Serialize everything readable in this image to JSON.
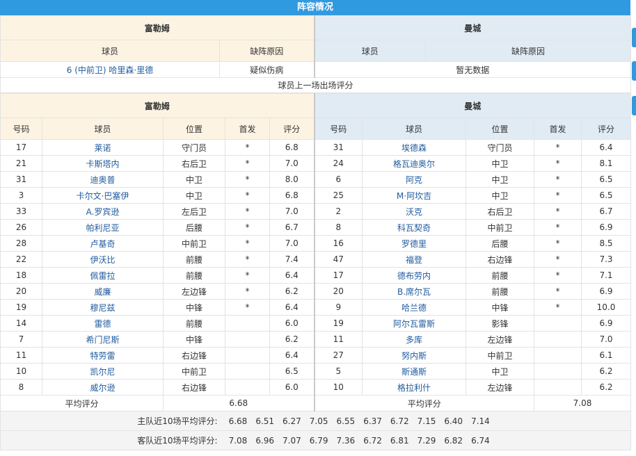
{
  "title": "阵容情况",
  "home_team": "富勒姆",
  "away_team": "曼城",
  "absence": {
    "col_player": "球员",
    "col_reason": "缺阵原因",
    "home_rows": [
      {
        "player": "6 (中前卫) 哈里森·里德",
        "reason": "疑似伤病"
      }
    ],
    "away_empty": "暂无数据"
  },
  "ratings_section": "球员上一场出场评分",
  "cols": {
    "num": "号码",
    "player": "球员",
    "pos": "位置",
    "start": "首发",
    "rating": "评分"
  },
  "home_players": [
    {
      "num": "17",
      "name": "莱诺",
      "pos": "守门员",
      "start": "*",
      "rating": "6.8"
    },
    {
      "num": "21",
      "name": "卡斯塔内",
      "pos": "右后卫",
      "start": "*",
      "rating": "7.0"
    },
    {
      "num": "31",
      "name": "迪奥普",
      "pos": "中卫",
      "start": "*",
      "rating": "8.0"
    },
    {
      "num": "3",
      "name": "卡尔文·巴塞伊",
      "pos": "中卫",
      "start": "*",
      "rating": "6.8"
    },
    {
      "num": "33",
      "name": "A.罗宾逊",
      "pos": "左后卫",
      "start": "*",
      "rating": "7.0"
    },
    {
      "num": "26",
      "name": "帕利尼亚",
      "pos": "后腰",
      "start": "*",
      "rating": "6.7"
    },
    {
      "num": "28",
      "name": "卢基奇",
      "pos": "中前卫",
      "start": "*",
      "rating": "7.0"
    },
    {
      "num": "22",
      "name": "伊沃比",
      "pos": "前腰",
      "start": "*",
      "rating": "7.4"
    },
    {
      "num": "18",
      "name": "佩雷拉",
      "pos": "前腰",
      "start": "*",
      "rating": "6.4"
    },
    {
      "num": "20",
      "name": "威廉",
      "pos": "左边锋",
      "start": "*",
      "rating": "6.2"
    },
    {
      "num": "19",
      "name": "穆尼兹",
      "pos": "中锋",
      "start": "*",
      "rating": "6.4"
    },
    {
      "num": "14",
      "name": "雷德",
      "pos": "前腰",
      "start": "",
      "rating": "6.0"
    },
    {
      "num": "7",
      "name": "希门尼斯",
      "pos": "中锋",
      "start": "",
      "rating": "6.2"
    },
    {
      "num": "11",
      "name": "特劳雷",
      "pos": "右边锋",
      "start": "",
      "rating": "6.4"
    },
    {
      "num": "10",
      "name": "凯尔尼",
      "pos": "中前卫",
      "start": "",
      "rating": "6.5"
    },
    {
      "num": "8",
      "name": "威尔逊",
      "pos": "右边锋",
      "start": "",
      "rating": "6.0"
    }
  ],
  "away_players": [
    {
      "num": "31",
      "name": "埃德森",
      "pos": "守门员",
      "start": "*",
      "rating": "6.4"
    },
    {
      "num": "24",
      "name": "格瓦迪奥尔",
      "pos": "中卫",
      "start": "*",
      "rating": "8.1"
    },
    {
      "num": "6",
      "name": "阿克",
      "pos": "中卫",
      "start": "*",
      "rating": "6.5"
    },
    {
      "num": "25",
      "name": "M·阿坎吉",
      "pos": "中卫",
      "start": "*",
      "rating": "6.5"
    },
    {
      "num": "2",
      "name": "沃克",
      "pos": "右后卫",
      "start": "*",
      "rating": "6.7"
    },
    {
      "num": "8",
      "name": "科瓦契奇",
      "pos": "中前卫",
      "start": "*",
      "rating": "6.9"
    },
    {
      "num": "16",
      "name": "罗德里",
      "pos": "后腰",
      "start": "*",
      "rating": "8.5"
    },
    {
      "num": "47",
      "name": "福登",
      "pos": "右边锋",
      "start": "*",
      "rating": "7.3"
    },
    {
      "num": "17",
      "name": "德布劳内",
      "pos": "前腰",
      "start": "*",
      "rating": "7.1"
    },
    {
      "num": "20",
      "name": "B.席尔瓦",
      "pos": "前腰",
      "start": "*",
      "rating": "6.9"
    },
    {
      "num": "9",
      "name": "哈兰德",
      "pos": "中锋",
      "start": "*",
      "rating": "10.0"
    },
    {
      "num": "19",
      "name": "阿尔瓦雷斯",
      "pos": "影锋",
      "start": "",
      "rating": "6.9"
    },
    {
      "num": "11",
      "name": "多库",
      "pos": "左边锋",
      "start": "",
      "rating": "7.0"
    },
    {
      "num": "27",
      "name": "努内斯",
      "pos": "中前卫",
      "start": "",
      "rating": "6.1"
    },
    {
      "num": "5",
      "name": "斯通斯",
      "pos": "中卫",
      "start": "",
      "rating": "6.2"
    },
    {
      "num": "10",
      "name": "格拉利什",
      "pos": "左边锋",
      "start": "",
      "rating": "6.2"
    }
  ],
  "avg_label": "平均评分",
  "home_avg": "6.68",
  "away_avg": "7.08",
  "home_recent_label": "主队近10场平均评分:",
  "home_recent": [
    "6.68",
    "6.51",
    "6.27",
    "7.05",
    "6.55",
    "6.37",
    "6.72",
    "7.15",
    "6.40",
    "7.14"
  ],
  "away_recent_label": "客队近10场平均评分:",
  "away_recent": [
    "7.08",
    "6.96",
    "7.07",
    "6.79",
    "7.36",
    "6.72",
    "6.81",
    "7.29",
    "6.82",
    "6.74"
  ]
}
